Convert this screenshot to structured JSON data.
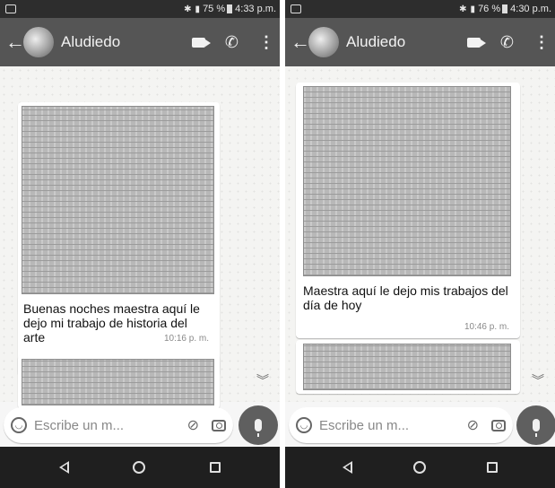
{
  "screens": [
    {
      "status": {
        "battery": "75 %",
        "time": "4:33 p.m."
      },
      "header": {
        "contact_name": "Aludiedo"
      },
      "messages": [
        {
          "caption": "Buenas noches maestra aquí le dejo mi trabajo de historia del arte",
          "time": "10:16 p. m."
        }
      ],
      "composer": {
        "placeholder": "Escribe un m..."
      }
    },
    {
      "status": {
        "battery": "76 %",
        "time": "4:30 p.m."
      },
      "header": {
        "contact_name": "Aludiedo"
      },
      "messages": [
        {
          "caption": "Maestra aquí le dejo mis trabajos del día de hoy",
          "time": "10:46 p. m."
        }
      ],
      "composer": {
        "placeholder": "Escribe un m..."
      }
    }
  ],
  "icons": {
    "back": "arrow-left",
    "video_call": "video-camera",
    "voice_call": "phone",
    "menu": "more-vert",
    "emoji": "smiley",
    "attach": "paperclip",
    "camera": "camera",
    "mic": "microphone",
    "scroll_down": "double-chevron-down"
  },
  "colors": {
    "app_bar": "#555555",
    "status_bar": "#2d2d2d",
    "nav_bar": "#1f1f1f",
    "mic_button": "#5f5f5f"
  }
}
